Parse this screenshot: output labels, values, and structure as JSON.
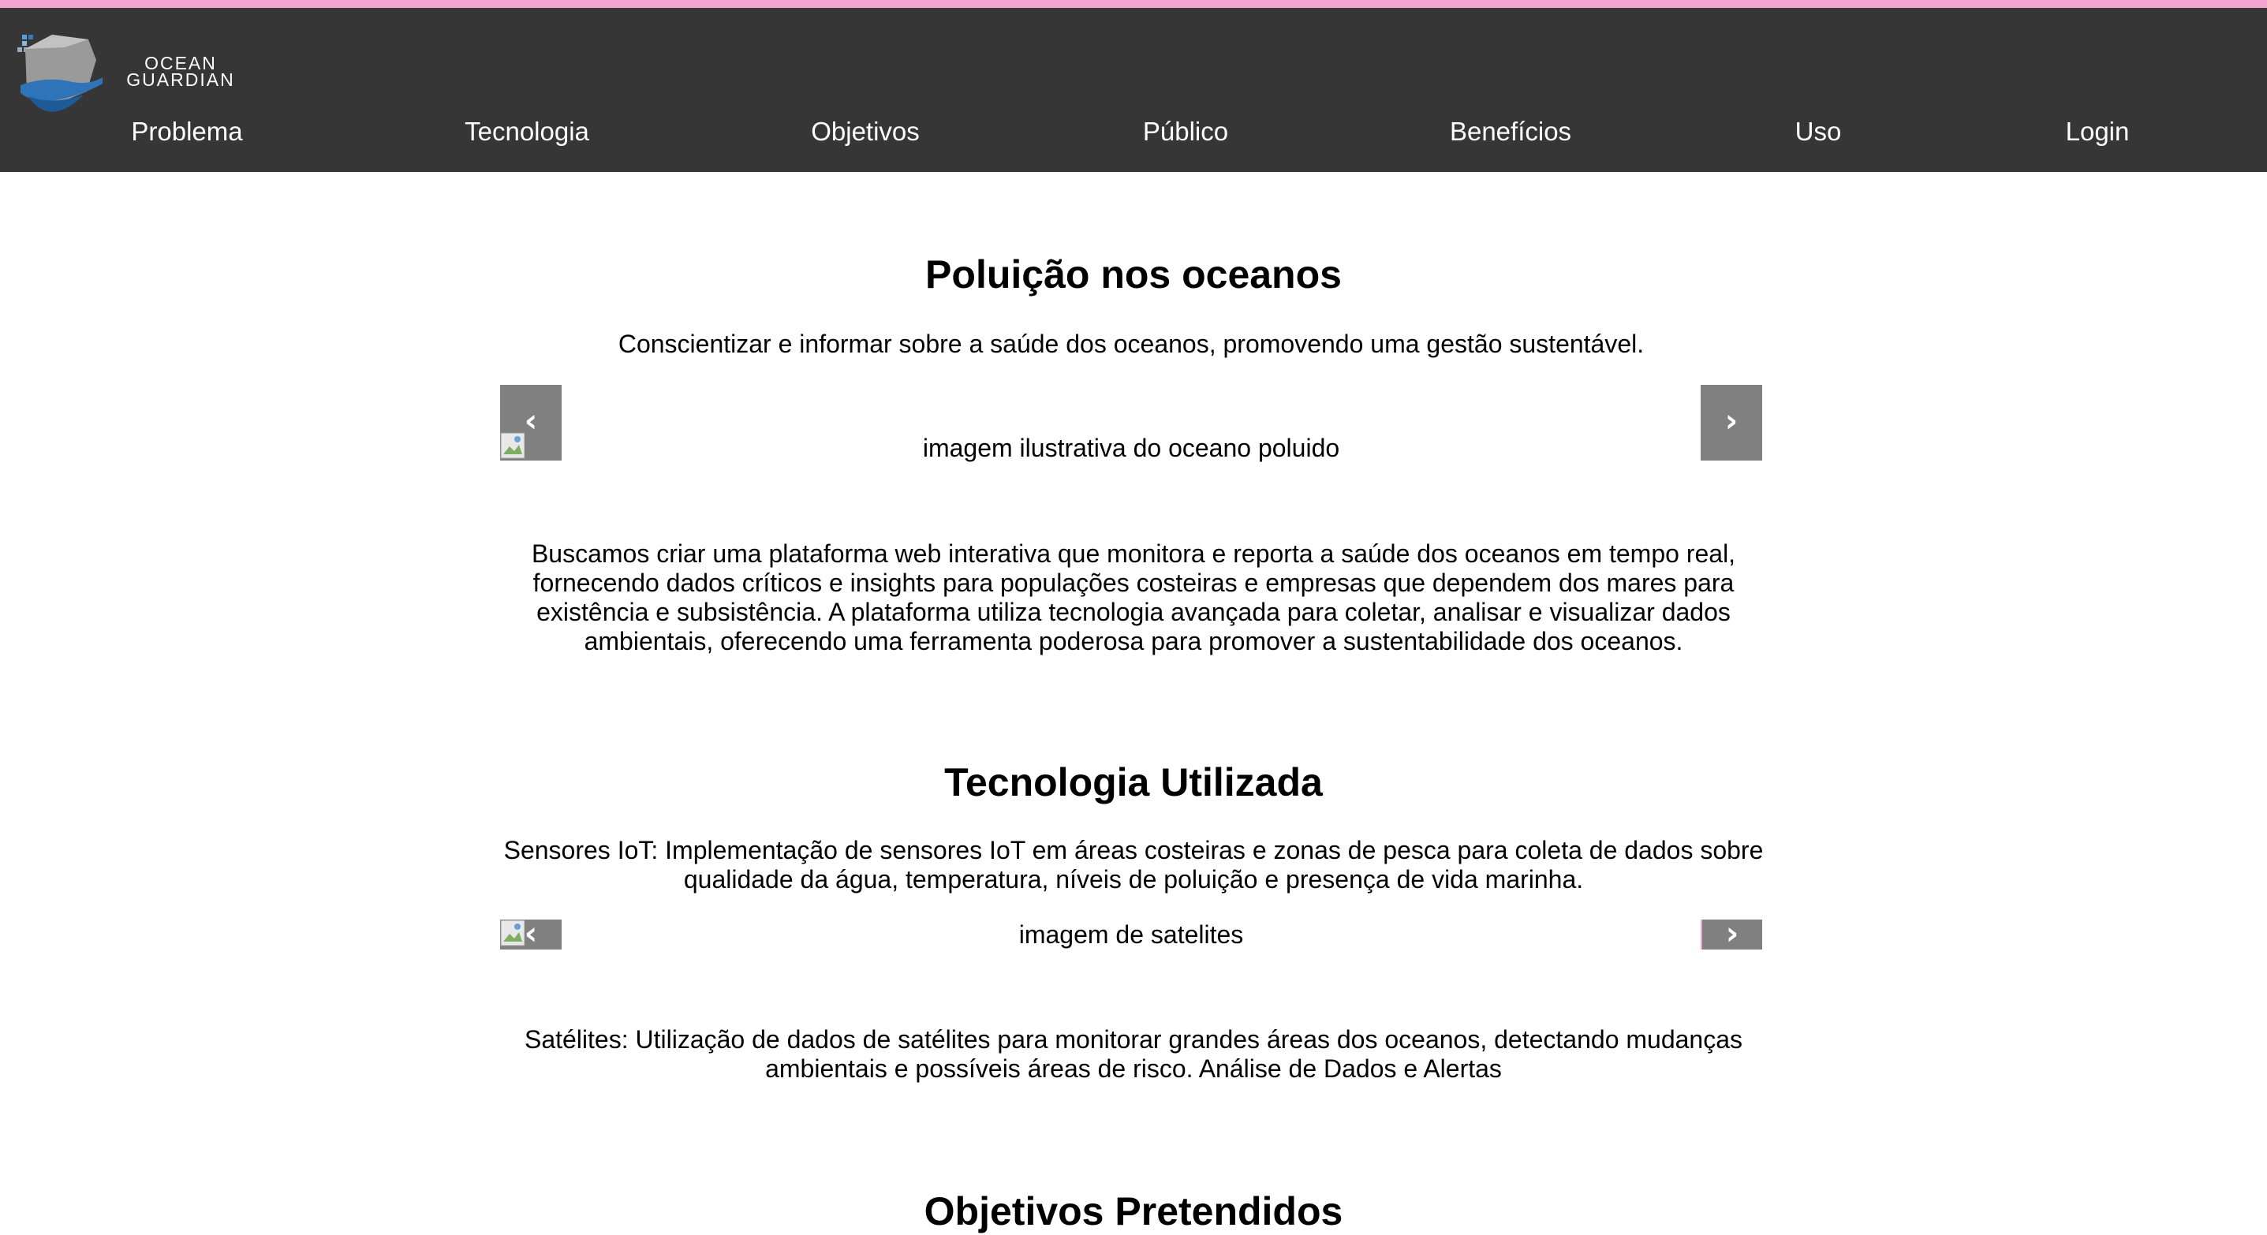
{
  "brand": {
    "logo_line1": "OCEAN",
    "logo_line2": "GUARDIAN",
    "colors": {
      "header_bg": "#363636",
      "accent_strip": "#f1a5cf",
      "carousel_button": "#808080"
    }
  },
  "nav": {
    "items": [
      {
        "label": "Problema"
      },
      {
        "label": "Tecnologia"
      },
      {
        "label": "Objetivos"
      },
      {
        "label": "Público"
      },
      {
        "label": "Benefícios"
      },
      {
        "label": "Uso"
      },
      {
        "label": "Login"
      }
    ]
  },
  "sections": [
    {
      "title": "Poluição nos oceanos",
      "subtitle": "Conscientizar e informar sobre a saúde dos oceanos, promovendo uma gestão sustentável.",
      "image_alt": "imagem ilustrativa do oceano poluido",
      "prev_label": "‹",
      "next_label": "›",
      "body": "Buscamos criar uma plataforma web interativa que monitora e reporta a saúde dos oceanos em tempo real, fornecendo dados críticos e insights para populações costeiras e empresas que dependem dos mares para existência e subsistência. A plataforma utiliza tecnologia avançada para coletar, analisar e visualizar dados ambientais, oferecendo uma ferramenta poderosa para promover a sustentabilidade dos oceanos."
    },
    {
      "title": "Tecnologia Utilizada",
      "subtitle": "Sensores IoT: Implementação de sensores IoT em áreas costeiras e zonas de pesca para coleta de dados sobre qualidade da água, temperatura, níveis de poluição e presença de vida marinha.",
      "image_alt": "imagem de satelites",
      "prev_label": "‹",
      "next_label": "›",
      "body": "Satélites: Utilização de dados de satélites para monitorar grandes áreas dos oceanos, detectando mudanças ambientais e possíveis áreas de risco. Análise de Dados e Alertas"
    },
    {
      "title": "Objetivos Pretendidos"
    }
  ]
}
